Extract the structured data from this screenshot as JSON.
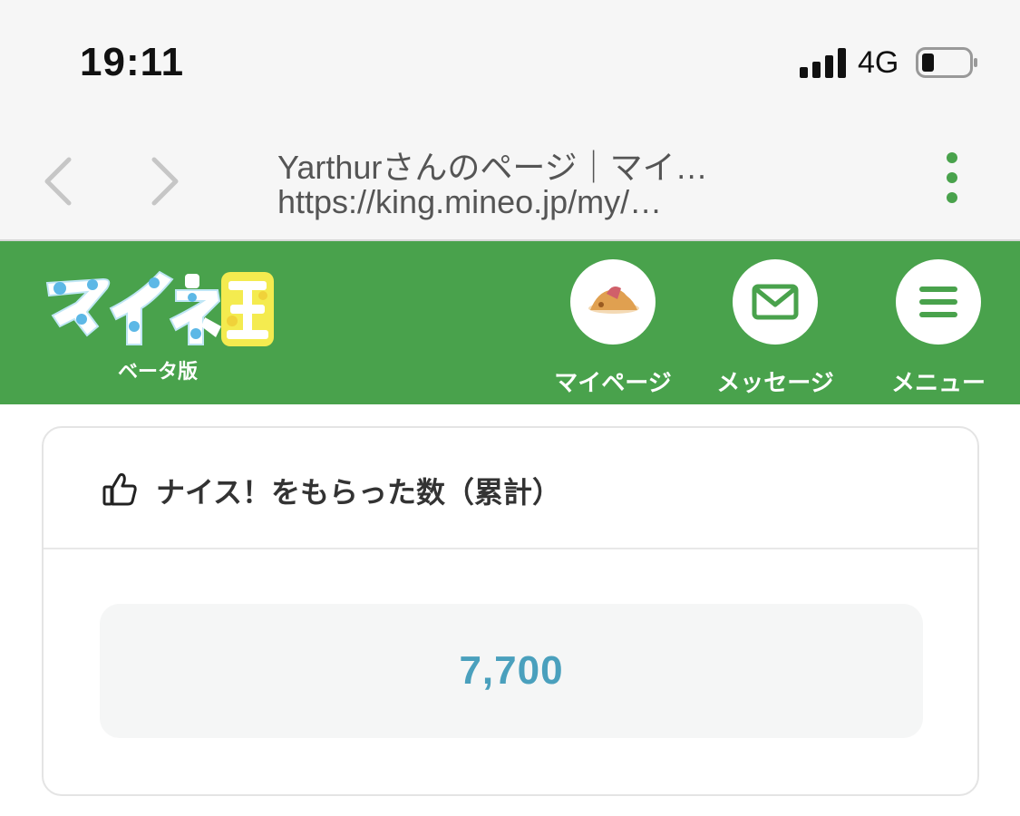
{
  "status_bar": {
    "time": "19:11",
    "network": "4G",
    "icons": [
      "signal-icon",
      "battery-icon"
    ]
  },
  "browser": {
    "back_icon": "chevron-left-icon",
    "forward_icon": "chevron-right-icon",
    "page_title": "Yarthurさんのページ｜マイ…",
    "url": "https://king.mineo.jp/my/…",
    "menu_icon": "kebab-menu-icon"
  },
  "header": {
    "logo_text": "マイネ王",
    "logo_sub": "ベータ版",
    "nav": [
      {
        "label": "マイページ",
        "icon": "avatar"
      },
      {
        "label": "メッセージ",
        "icon": "envelope-icon"
      },
      {
        "label": "メニュー",
        "icon": "hamburger-icon"
      }
    ],
    "bg_color": "#49a24c"
  },
  "card": {
    "icon": "thumbs-up-icon",
    "title": "ナイス！をもらった数（累計）",
    "count": "7,700",
    "count_color": "#4aa0bd"
  }
}
